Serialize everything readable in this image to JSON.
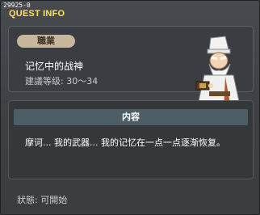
{
  "window": {
    "quest_id": "29925-0",
    "title": "QUEST INFO"
  },
  "quest": {
    "job_label": "職業",
    "name": "记忆中的战神",
    "recommended_level": "建議等级: 30～34",
    "npc_icon": "old-sage-npc-portrait"
  },
  "content": {
    "header": "内容",
    "text": "摩诃... 我的武器... 我的记忆在一点一点逐渐恢复。"
  },
  "status": {
    "text": "狀態: 可開始"
  },
  "colors": {
    "title": "#ffe25a",
    "pill": "#c7b79d",
    "content_header": "#4e5e66"
  }
}
